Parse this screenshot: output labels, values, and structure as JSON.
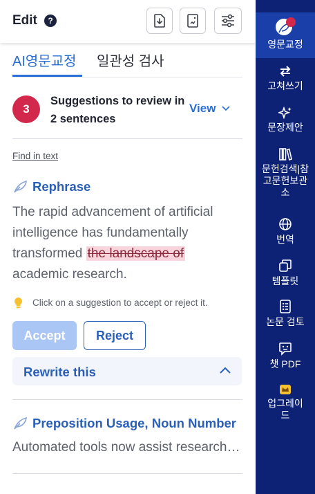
{
  "header": {
    "title": "Edit",
    "help_glyph": "?",
    "buttons": [
      "download-icon",
      "document-icon",
      "sliders-icon"
    ]
  },
  "tabs": [
    {
      "label": "AI영문교정",
      "active": true
    },
    {
      "label": "일관성 검사",
      "active": false
    }
  ],
  "summary": {
    "count": "3",
    "text": "Suggestions to review in 2 sentences",
    "view_label": "View"
  },
  "find_in_text": "Find in text",
  "suggestion": {
    "title": "Rephrase",
    "sentence_before": "The rapid advancement of artificial intelligence has fundamentally transformed ",
    "deleted_text": "the landscape of",
    "sentence_after": "academic research.",
    "hint": "Click on a suggestion to accept or reject it.",
    "accept_label": "Accept",
    "reject_label": "Reject",
    "rewrite_label": "Rewrite this"
  },
  "suggestion2": {
    "title": "Preposition Usage, Noun Number",
    "sentence": "Automated tools now assist researchers in analyzing data"
  },
  "sidebar": {
    "items": [
      {
        "label": "영문교정",
        "icon": "feather-icon",
        "active": true
      },
      {
        "label": "고쳐쓰기",
        "icon": "swap-arrows-icon"
      },
      {
        "label": "문장제안",
        "icon": "sparkle-icon"
      },
      {
        "label": "문헌검색|참고문헌보관소",
        "icon": "books-icon"
      },
      {
        "label": "번역",
        "icon": "globe-icon"
      },
      {
        "label": "템플릿",
        "icon": "copy-icon"
      },
      {
        "label": "논문 검토",
        "icon": "checklist-icon"
      },
      {
        "label": "챗 PDF",
        "icon": "chat-bot-icon"
      },
      {
        "label": "업그레이드",
        "icon": "crown-icon"
      }
    ]
  },
  "colors": {
    "accent": "#2a6fd6",
    "badge": "#d2284c",
    "sidebar_bg": "#0e2275",
    "sidebar_active": "#1b3fa8",
    "strike_bg": "#f9d4dc"
  }
}
